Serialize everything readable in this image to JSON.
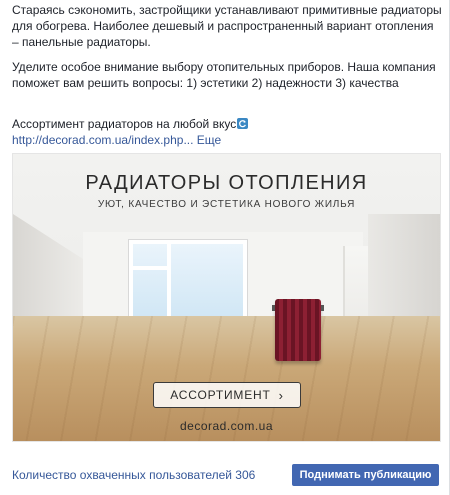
{
  "post": {
    "paragraph1": "Стараясь сэкономить, застройщики устанавливают примитивные радиаторы для обогрева. Наиболее дешевый и распространенный вариант отопления – панельные радиаторы.",
    "paragraph2": "Уделите особое внимание выбору отопительных приборов. Наша компания поможет вам решить вопросы: 1) эстетики 2) надежности 3) качества",
    "paragraph3": "Ассортимент радиаторов на любой вкус",
    "link": "http://decorad.com.ua/index.php...",
    "more": "Еще"
  },
  "ad": {
    "title": "РАДИАТОРЫ ОТОПЛЕНИЯ",
    "subtitle": "УЮТ, КАЧЕСТВО И ЭСТЕТИКА НОВОГО ЖИЛЬЯ",
    "button": "АССОРТИМЕНТ",
    "domain": "decorad.com.ua"
  },
  "footer": {
    "reach": "Количество охваченных пользователей 306",
    "boost": "Поднимать публикацию"
  },
  "colors": {
    "link": "#365899",
    "boost_button": "#4267b2",
    "radiator": "#7a1a2c"
  },
  "icons": [
    "refresh-icon",
    "chevron-right-icon"
  ]
}
